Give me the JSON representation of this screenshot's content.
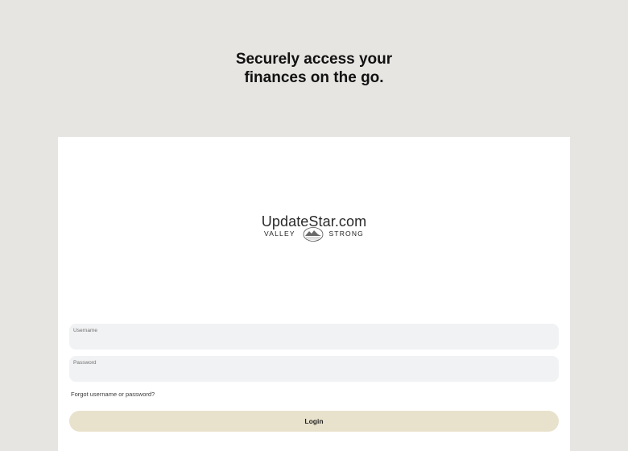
{
  "headline": {
    "line1": "Securely access your",
    "line2": "finances on the go."
  },
  "logo": {
    "watermark_text": "UpdateStar.com",
    "brand_left": "VALLEY",
    "brand_right": "STRONG",
    "emblem_icon": "mountain-seal-icon"
  },
  "form": {
    "username_label": "Username",
    "username_value": "",
    "password_label": "Password",
    "password_value": "",
    "forgot_link": "Forgot username or password?",
    "login_button": "Login"
  },
  "colors": {
    "page_background": "#e6e5e2",
    "card_background": "#ffffff",
    "field_background": "#f1f2f3",
    "button_background": "#e8e1cc"
  }
}
